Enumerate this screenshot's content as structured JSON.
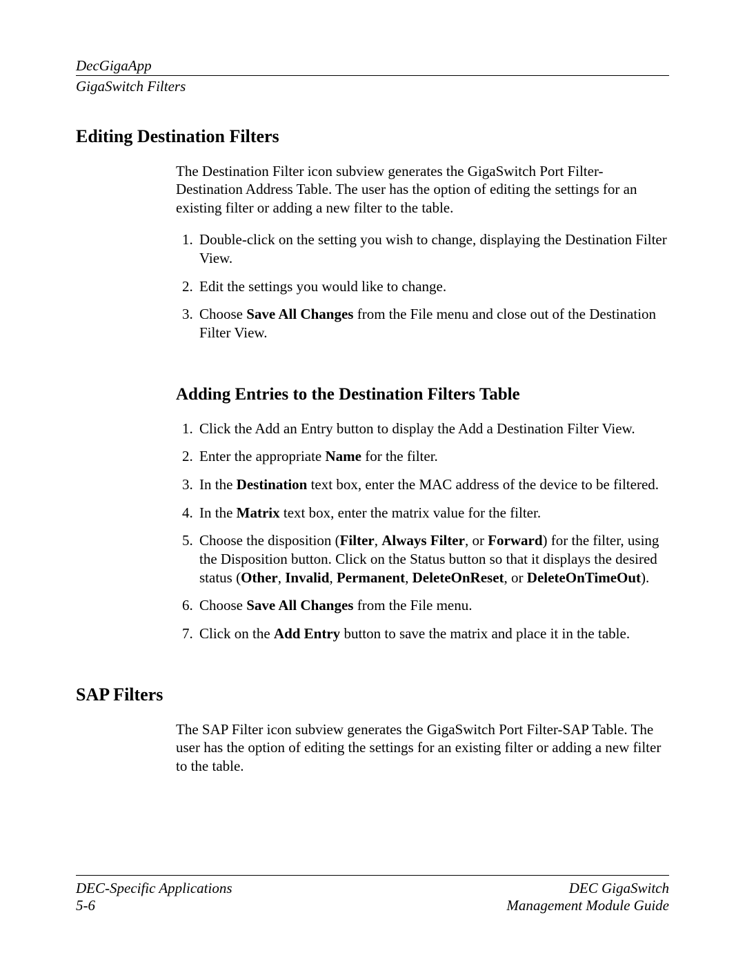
{
  "header": {
    "line1": "DecGigaApp",
    "line2": "GigaSwitch Filters"
  },
  "section_edit": {
    "title": "Editing Destination Filters",
    "intro": "The Destination Filter icon subview generates the GigaSwitch Port Filter-Destination Address Table. The user has the option of editing the settings for an existing filter or adding a new filter to the table.",
    "steps": {
      "s1": "Double-click on the setting you wish to change, displaying the Destination Filter View.",
      "s2": "Edit the settings you would like to change.",
      "s3_a": "Choose ",
      "s3_b": "Save All Changes",
      "s3_c": " from the File menu and close out of the Destination Filter View."
    }
  },
  "section_add": {
    "title": "Adding Entries to the Destination Filters Table",
    "steps": {
      "s1": "Click the Add an Entry button to display the Add a Destination Filter View.",
      "s2_a": "Enter the appropriate ",
      "s2_b": "Name",
      "s2_c": " for the filter.",
      "s3_a": "In the ",
      "s3_b": "Destination",
      "s3_c": " text box, enter the MAC address of the device to be filtered.",
      "s4_a": "In the ",
      "s4_b": "Matrix",
      "s4_c": " text box, enter the matrix value for the filter.",
      "s5_a": "Choose the disposition (",
      "s5_b": "Filter",
      "s5_c": ", ",
      "s5_d": "Always Filter",
      "s5_e": ", or ",
      "s5_f": "Forward",
      "s5_g": ") for the filter, using the Disposition button. Click on the Status button so that it displays the desired status (",
      "s5_h": "Other",
      "s5_i": ", ",
      "s5_j": "Invalid",
      "s5_k": ", ",
      "s5_l": "Permanent",
      "s5_m": ", ",
      "s5_n": "DeleteOnReset",
      "s5_o": ", or ",
      "s5_p": "DeleteOnTimeOut",
      "s5_q": ").",
      "s6_a": "Choose ",
      "s6_b": "Save All Changes",
      "s6_c": " from the File menu.",
      "s7_a": "Click on the ",
      "s7_b": "Add Entry",
      "s7_c": " button to save the matrix and place it in the table."
    }
  },
  "section_sap": {
    "title": "SAP Filters",
    "intro": "The SAP Filter icon subview generates the GigaSwitch Port Filter-SAP Table. The user has the option of editing the settings for an existing filter or adding a new filter to the table."
  },
  "footer": {
    "left1": "DEC-Specific Applications",
    "left2": "5-6",
    "right1": "DEC GigaSwitch",
    "right2": "Management Module Guide"
  }
}
